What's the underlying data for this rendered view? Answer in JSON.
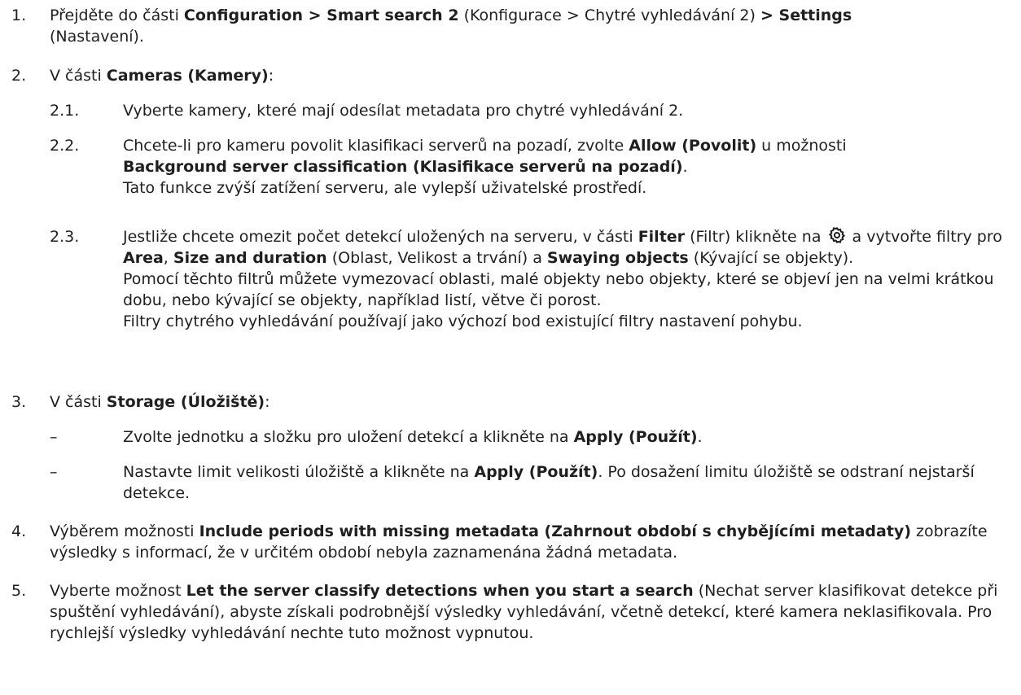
{
  "steps": [
    {
      "num": "1.",
      "parts": [
        "Přejděte do části ",
        "Configuration > Smart search 2",
        " (Konfigurace > Chytré vyhledávání 2) ",
        "> Settings",
        " (Nastavení)."
      ]
    },
    {
      "num": "2.",
      "parts": [
        "V části ",
        "Cameras (Kamery)",
        ":"
      ],
      "substeps": [
        {
          "num": "2.1.",
          "text": "Vyberte kamery, které mají odesílat metadata pro chytré vyhledávání 2."
        },
        {
          "num": "2.2.",
          "parts": [
            "Chcete-li pro kameru povolit klasifikaci serverů na pozadí, zvolte ",
            "Allow (Povolit)",
            " u možnosti",
            "Background server classification (Klasifikace serverů na pozadí)",
            "."
          ],
          "note": "Tato funkce zvýší zatížení serveru, ale vylepší uživatelské prostředí."
        },
        {
          "num": "2.3.",
          "parts": [
            "Jestliže chcete omezit počet detekcí uložených na serveru, v části ",
            "Filter",
            " (Filtr) klikněte na ",
            " a vytvořte filtry pro ",
            "Area",
            ", ",
            "Size and duration",
            " (Oblast, Velikost a trvání) a ",
            "Swaying objects",
            " (Kývající se objekty)."
          ],
          "note1": "Pomocí těchto filtrů můžete vymezovací oblasti, malé objekty nebo objekty, které se objeví jen na velmi krátkou dobu, nebo kývající se objekty, například listí, větve či porost.",
          "note2": "Filtry chytrého vyhledávání používají jako výchozí bod existující filtry nastavení pohybu.",
          "icon": "gear-icon"
        }
      ]
    },
    {
      "num": "3.",
      "parts": [
        "V části ",
        "Storage (Úložiště)",
        ":"
      ],
      "substeps": [
        {
          "num": "–",
          "parts": [
            "Zvolte jednotku a složku pro uložení detekcí a klikněte na ",
            "Apply (Použít)",
            "."
          ]
        },
        {
          "num": "–",
          "parts": [
            "Nastavte limit velikosti úložiště a klikněte na ",
            "Apply (Použít)",
            ". Po dosažení limitu úložiště se odstraní nejstarší detekce."
          ]
        }
      ]
    },
    {
      "num": "4.",
      "parts": [
        "Výběrem možnosti ",
        "Include periods with missing metadata (Zahrnout období s chybějícími metadaty)",
        " zobrazíte výsledky s informací, že v určitém období nebyla zaznamenána žádná metadata."
      ]
    },
    {
      "num": "5.",
      "parts": [
        "Vyberte možnost ",
        "Let the server classify detections when you start a search",
        " (Nechat server klasifikovat detekce při spuštění vyhledávání), abyste získali podrobnější výsledky vyhledávání, včetně detekcí, které kamera neklasifikovala. Pro rychlejší výsledky vyhledávání nechte tuto možnost vypnutou."
      ]
    }
  ]
}
